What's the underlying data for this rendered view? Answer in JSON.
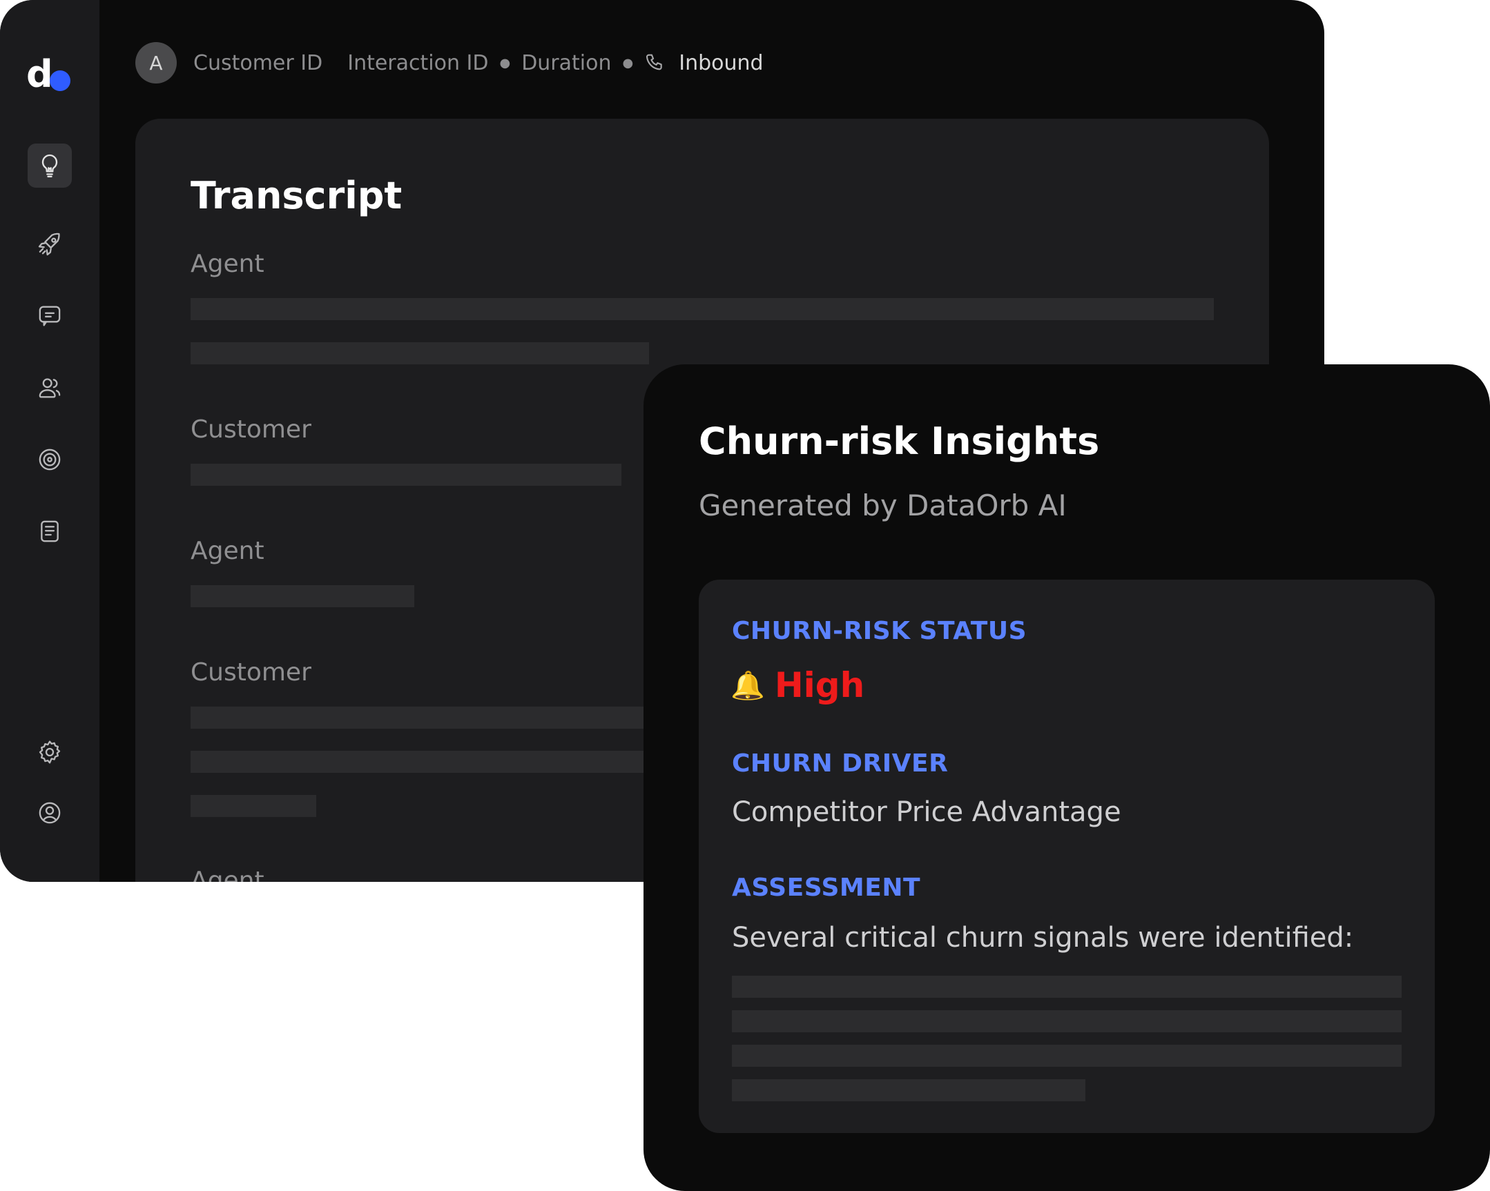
{
  "app": {
    "logo_letter": "d",
    "brand_color": "#2f5cff"
  },
  "sidebar": {
    "items": [
      {
        "icon": "lightbulb-icon",
        "active": true
      },
      {
        "icon": "rocket-icon",
        "active": false
      },
      {
        "icon": "chat-icon",
        "active": false
      },
      {
        "icon": "users-icon",
        "active": false
      },
      {
        "icon": "target-icon",
        "active": false
      },
      {
        "icon": "document-icon",
        "active": false
      },
      {
        "icon": "gear-icon",
        "active": false
      },
      {
        "icon": "user-circle-icon",
        "active": false
      }
    ]
  },
  "header": {
    "avatar_initial": "A",
    "customer_id": "Customer ID",
    "interaction_id": "Interaction ID",
    "duration": "Duration",
    "direction": "Inbound",
    "direction_icon": "phone-icon"
  },
  "transcript": {
    "title": "Transcript",
    "turns": [
      {
        "speaker": "Agent"
      },
      {
        "speaker": "Customer"
      },
      {
        "speaker": "Agent"
      },
      {
        "speaker": "Customer"
      },
      {
        "speaker": "Agent"
      }
    ]
  },
  "insights": {
    "title": "Churn-risk Insights",
    "subtitle": "Generated by DataOrb AI",
    "status_label": "CHURN-RISK STATUS",
    "status_icon": "bell-icon",
    "status_value": "High",
    "status_color": "#ee1b1b",
    "driver_label": "CHURN DRIVER",
    "driver_value": "Competitor Price Advantage",
    "assessment_label": "ASSESSMENT",
    "assessment_text": "Several critical churn signals were identified:",
    "label_color": "#5b82ff"
  }
}
